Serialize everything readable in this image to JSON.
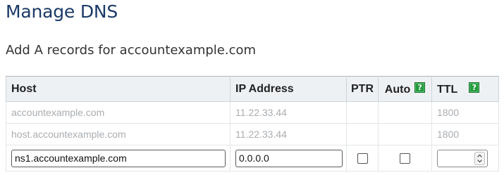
{
  "page": {
    "title": "Manage DNS",
    "subtitle": "Add A records for accountexample.com"
  },
  "table": {
    "headers": {
      "host": "Host",
      "ip": "IP Address",
      "ptr": "PTR",
      "auto": "Auto",
      "ttl": "TTL"
    },
    "help_icon": "help-icon",
    "help_glyph": "?",
    "rows": [
      {
        "host": "accountexample.com",
        "ip": "11.22.33.44",
        "ttl": "1800"
      },
      {
        "host": "host.accountexample.com",
        "ip": "11.22.33.44",
        "ttl": "1800"
      }
    ],
    "new_record": {
      "host": "ns1.accountexample.com",
      "ip": "0.0.0.0",
      "ptr_checked": false,
      "auto_checked": false,
      "ttl": ""
    }
  },
  "colors": {
    "title": "#1b3a66",
    "header_bg": "#eef1f4",
    "muted_text": "#a9adb1",
    "help_icon": "#239a3e"
  }
}
